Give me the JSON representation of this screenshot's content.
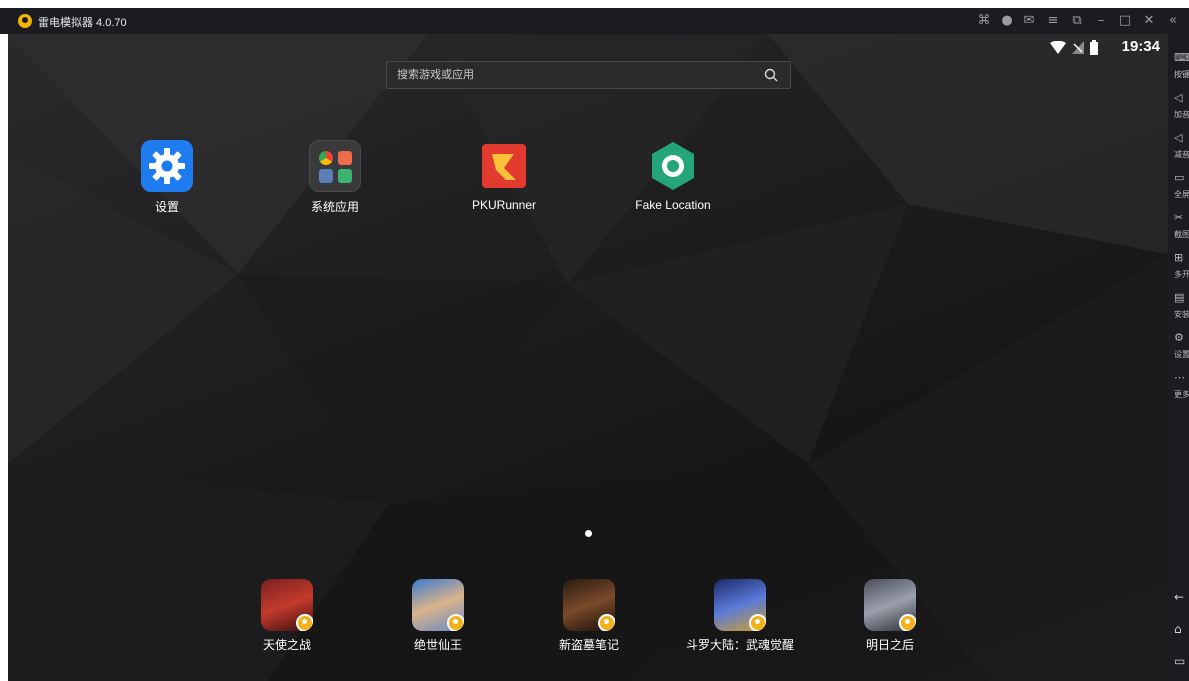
{
  "window": {
    "title": "雷电模拟器 4.0.70",
    "controls": [
      "gamepad-icon",
      "avatar-icon",
      "mail-icon",
      "menu-icon",
      "restore-window-icon",
      "minimize-icon",
      "maximize-icon",
      "close-icon",
      "collapse-sidebar-icon"
    ]
  },
  "status_bar": {
    "time": "19:34"
  },
  "search": {
    "placeholder": "搜索游戏或应用"
  },
  "home_apps": [
    {
      "label": "设置",
      "icon": "settings-gear-icon"
    },
    {
      "label": "系统应用",
      "icon": "system-apps-folder-icon"
    },
    {
      "label": "PKURunner",
      "icon": "pkurunner-icon"
    },
    {
      "label": "Fake Location",
      "icon": "fake-location-icon"
    }
  ],
  "dock_apps": [
    {
      "label": "天使之战"
    },
    {
      "label": "绝世仙王"
    },
    {
      "label": "新盗墓笔记"
    },
    {
      "label": "斗罗大陆：武魂觉醒"
    },
    {
      "label": "明日之后"
    }
  ],
  "sidebar": {
    "items": [
      {
        "label": "按键",
        "icon": "keyboard-icon"
      },
      {
        "label": "加音",
        "icon": "volume-up-icon"
      },
      {
        "label": "减音",
        "icon": "volume-down-icon"
      },
      {
        "label": "全屏",
        "icon": "fullscreen-icon"
      },
      {
        "label": "截图",
        "icon": "scissors-icon"
      },
      {
        "label": "多开",
        "icon": "multi-instance-icon"
      },
      {
        "label": "安装",
        "icon": "apk-install-icon"
      },
      {
        "label": "设置",
        "icon": "settings-icon"
      },
      {
        "label": "更多",
        "icon": "more-icon"
      }
    ],
    "nav": [
      "back-icon",
      "home-icon",
      "recents-icon"
    ]
  },
  "colors": {
    "accent": "#f5b400",
    "settings_blue": "#1e7cf0",
    "fake_location_green": "#24a57a",
    "pkurunner_red": "#e23a2e"
  }
}
